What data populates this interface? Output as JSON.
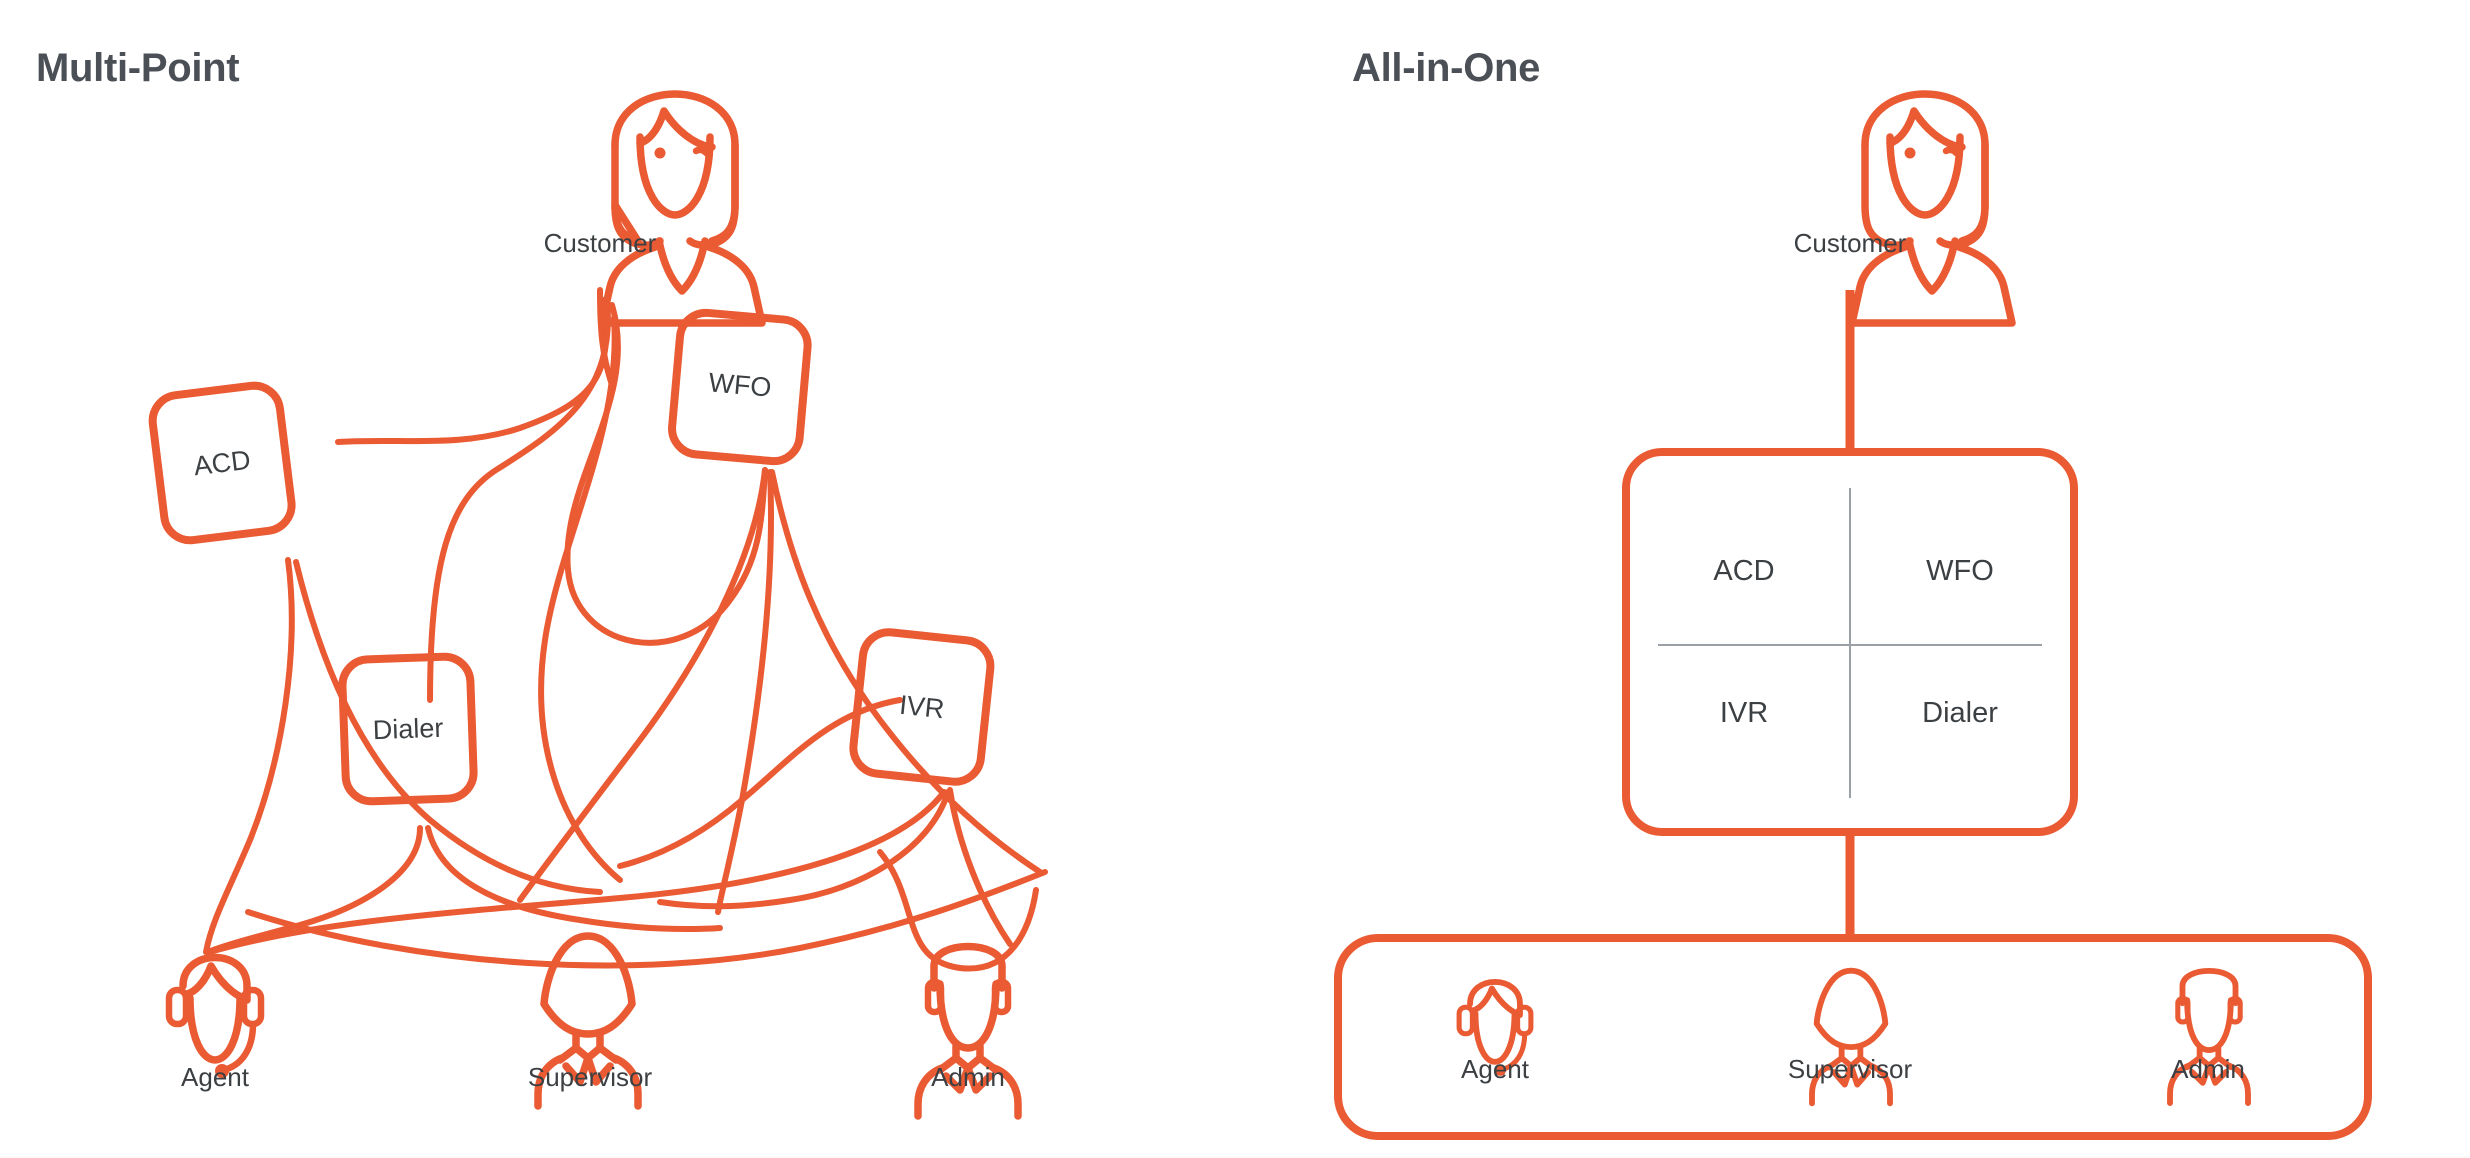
{
  "page": {
    "background": "#ffffff",
    "accent_color": "#ea5a33",
    "text_color": "#3c4043",
    "title_color": "#4b5057"
  },
  "panels": [
    {
      "id": "multi-point",
      "title": "Multi-Point",
      "customer": {
        "label": "Customer",
        "icon": "woman-customer-icon"
      },
      "nodes": [
        {
          "id": "acd",
          "label": "ACD"
        },
        {
          "id": "wfo",
          "label": "WFO"
        },
        {
          "id": "dialer",
          "label": "Dialer"
        },
        {
          "id": "ivr",
          "label": "IVR"
        }
      ],
      "roles": [
        {
          "id": "agent",
          "label": "Agent",
          "icon": "agent-headset-icon"
        },
        {
          "id": "supervisor",
          "label": "Supervisor",
          "icon": "supervisor-icon"
        },
        {
          "id": "admin",
          "label": "Admin",
          "icon": "admin-icon"
        }
      ]
    },
    {
      "id": "all-in-one",
      "title": "All-in-One",
      "customer": {
        "label": "Customer",
        "icon": "woman-customer-icon"
      },
      "quadrants": [
        {
          "id": "acd",
          "label": "ACD",
          "position": "top-left"
        },
        {
          "id": "wfo",
          "label": "WFO",
          "position": "top-right"
        },
        {
          "id": "ivr",
          "label": "IVR",
          "position": "bottom-left"
        },
        {
          "id": "dialer",
          "label": "Dialer",
          "position": "bottom-right"
        }
      ],
      "roles": [
        {
          "id": "agent",
          "label": "Agent",
          "icon": "agent-headset-icon"
        },
        {
          "id": "supervisor",
          "label": "Supervisor",
          "icon": "supervisor-icon"
        },
        {
          "id": "admin",
          "label": "Admin",
          "icon": "admin-icon"
        }
      ]
    }
  ]
}
